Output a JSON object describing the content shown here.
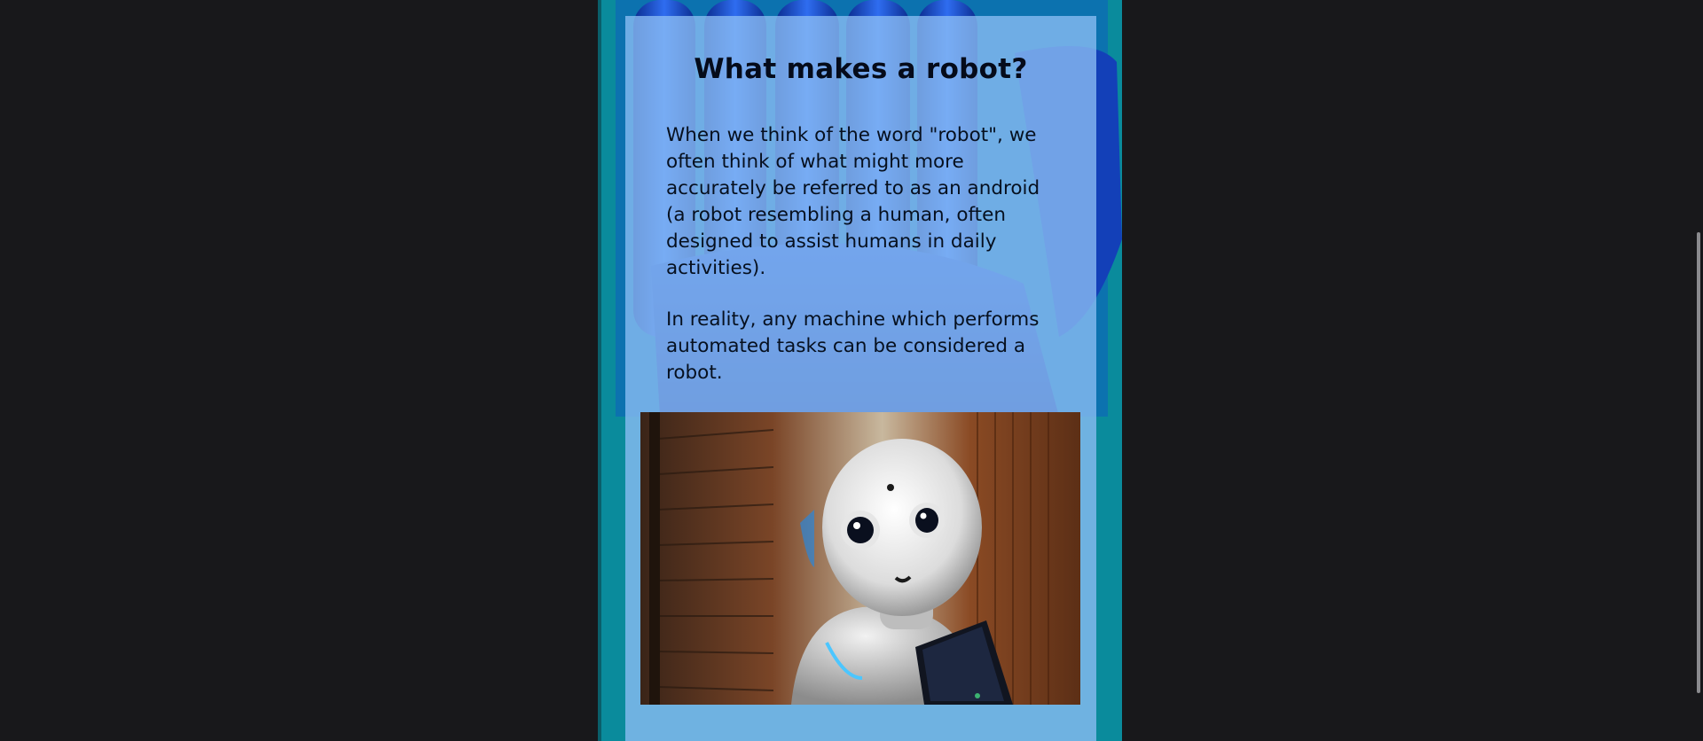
{
  "article": {
    "title": "What makes a robot?",
    "paragraphs": [
      "When we think of the word \"robot\", we often think of what might more accurately be referred to as an android (a robot resembling a human, often designed to assist humans in daily activities).",
      "In reality, any machine which performs automated tasks can be considered a robot."
    ]
  },
  "icons": {
    "background": "robot-hand-background-image",
    "photo": "humanoid-robot-photo"
  },
  "colors": {
    "page_background": "#18181b",
    "column_accent": "#0b99aa",
    "card_background": "#8cbef5",
    "text": "#06101f"
  }
}
